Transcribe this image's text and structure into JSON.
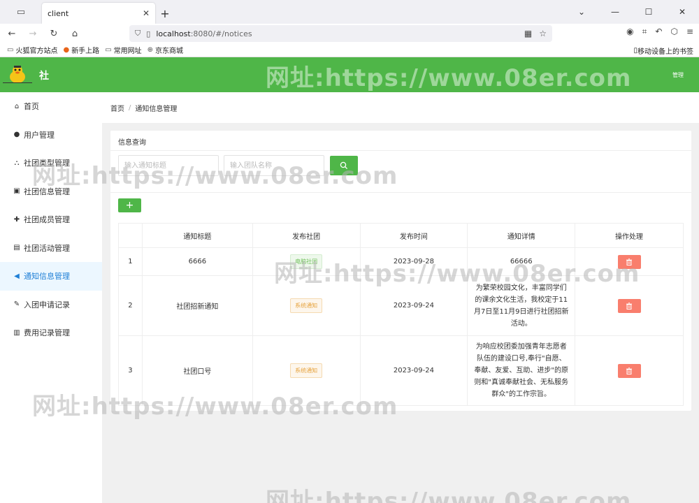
{
  "browser": {
    "tab_title": "client",
    "url_host": "localhost",
    "url_rest": ":8080/#/notices",
    "bookmarks": [
      "火狐官方站点",
      "新手上路",
      "常用网址",
      "京东商城"
    ],
    "mobile_bookmarks": "移动设备上的书签"
  },
  "app": {
    "title": "社",
    "user_label": "管理"
  },
  "sidebar": {
    "items": [
      {
        "label": "首页",
        "icon": "home-icon"
      },
      {
        "label": "用户管理",
        "icon": "user-icon"
      },
      {
        "label": "社团类型管理",
        "icon": "sitemap-icon"
      },
      {
        "label": "社团信息管理",
        "icon": "id-card-icon"
      },
      {
        "label": "社团成员管理",
        "icon": "user-plus-icon"
      },
      {
        "label": "社团活动管理",
        "icon": "calendar-icon"
      },
      {
        "label": "通知信息管理",
        "icon": "bullhorn-icon"
      },
      {
        "label": "入团申请记录",
        "icon": "edit-icon"
      },
      {
        "label": "费用记录管理",
        "icon": "bar-chart-icon"
      }
    ],
    "active_index": 6
  },
  "breadcrumb": {
    "home": "首页",
    "current": "通知信息管理"
  },
  "query": {
    "title": "信息查询",
    "title_placeholder": "输入通知标题",
    "club_placeholder": "输入团队名称"
  },
  "table": {
    "headers": [
      "",
      "通知标题",
      "发布社团",
      "发布时间",
      "通知详情",
      "操作处理"
    ],
    "rows": [
      {
        "idx": "1",
        "title": "6666",
        "club": "电脑社团",
        "club_color": "green",
        "time": "2023-09-28",
        "detail": "66666"
      },
      {
        "idx": "2",
        "title": "社团招新通知",
        "club": "系统通知",
        "club_color": "orange",
        "time": "2023-09-24",
        "detail": "为繁荣校园文化，丰富同学们的课余文化生活，我校定于11月7日至11月9日进行社团招新活动。"
      },
      {
        "idx": "3",
        "title": "社团口号",
        "club": "系统通知",
        "club_color": "orange",
        "time": "2023-09-24",
        "detail": "为响应校团委加强青年志愿者队伍的建设口号,奉行\"自愿、奉献、友爱、互助、进步\"的原则和\"真诚奉献社会、无私服务群众\"的工作宗旨。"
      }
    ]
  },
  "colors": {
    "primary": "#4fb648",
    "danger": "#f97e6d",
    "active_bg": "#ecf7ff",
    "active_text": "#1e7fd6"
  },
  "watermark": "网址:https://www.08er.com"
}
